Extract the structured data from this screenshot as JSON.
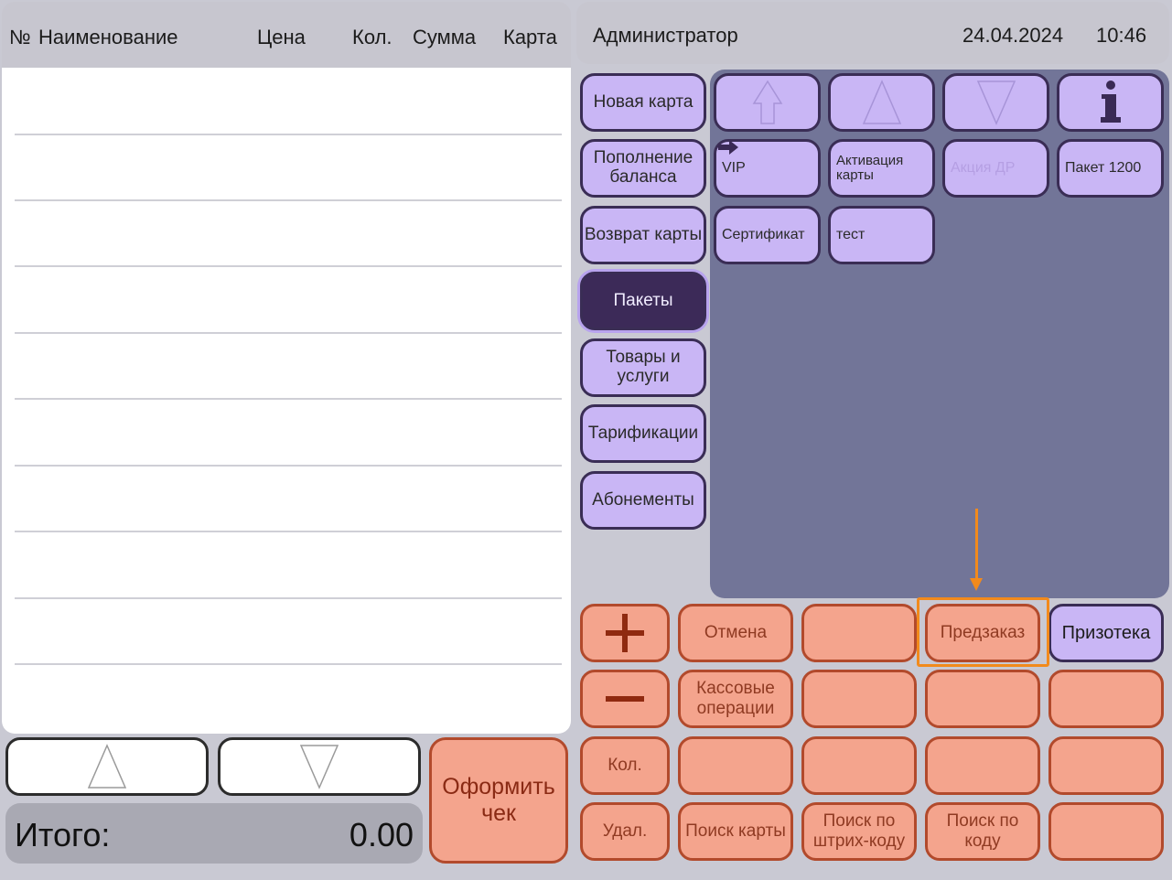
{
  "receipt": {
    "columns": [
      "№",
      "Наименование",
      "Цена",
      "Кол.",
      "Сумма",
      "Карта"
    ],
    "total_label": "Итого:",
    "total_value": "0.00",
    "checkout_label": "Оформить чек"
  },
  "header": {
    "user": "Администратор",
    "date": "24.04.2024",
    "time": "10:46"
  },
  "categories": [
    {
      "label": "Новая карта",
      "active": false
    },
    {
      "label": "Пополнение баланса",
      "active": false
    },
    {
      "label": "Возврат карты",
      "active": false
    },
    {
      "label": "Пакеты",
      "active": true
    },
    {
      "label": "Товары и услуги",
      "active": false
    },
    {
      "label": "Тарификации",
      "active": false
    },
    {
      "label": "Абонементы",
      "active": false
    }
  ],
  "nav_icons": [
    "scroll-top-icon",
    "scroll-up-icon",
    "scroll-down-icon",
    "info-icon"
  ],
  "items": [
    {
      "label": "VIP",
      "disabled": false
    },
    {
      "label": "Активация карты",
      "disabled": false
    },
    {
      "label": "Акция ДР",
      "disabled": true
    },
    {
      "label": "Пакет 1200",
      "disabled": false
    },
    {
      "label": "Сертификат",
      "disabled": false
    },
    {
      "label": "тест",
      "disabled": false
    }
  ],
  "actions": {
    "cancel": "Отмена",
    "preorder": "Предзаказ",
    "prizoteka": "Призотека",
    "cash_ops": "Кассовые операции",
    "qty": "Кол.",
    "delete": "Удал.",
    "search_card": "Поиск карты",
    "search_barcode": "Поиск по штрих-коду",
    "search_code": "Поиск по коду"
  },
  "colors": {
    "accent_purple": "#c9b6f5",
    "active_purple": "#3c2a58",
    "action_orange": "#f4a48d",
    "highlight": "#f28a1c"
  }
}
